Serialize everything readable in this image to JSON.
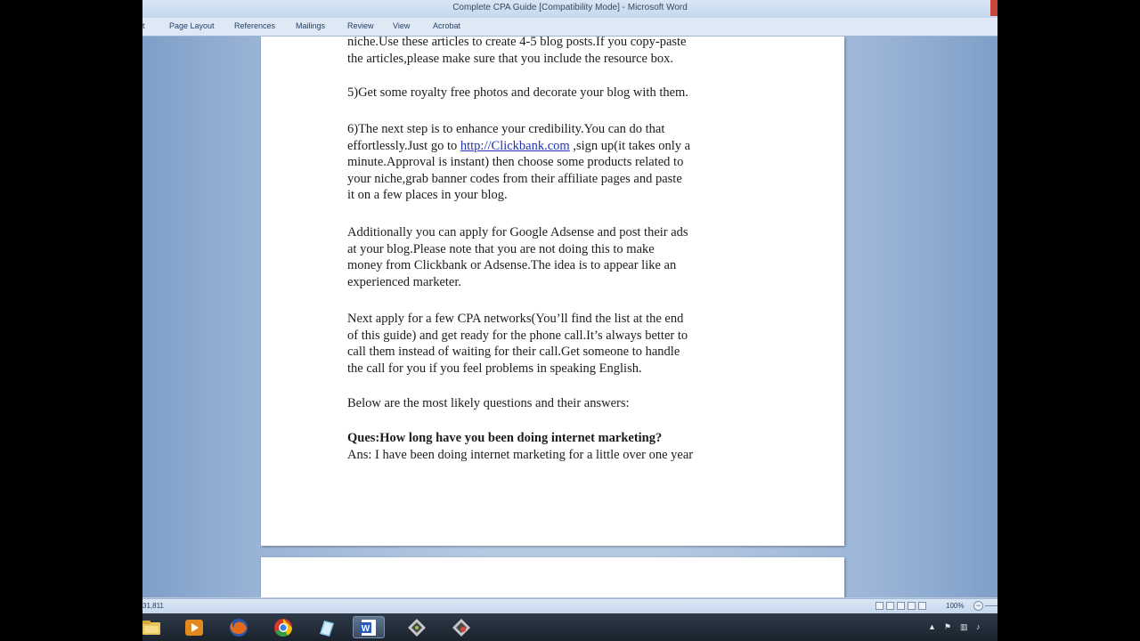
{
  "window": {
    "title": "Complete CPA Guide [Compatibility Mode] - Microsoft Word"
  },
  "ribbon": {
    "tabs": [
      "t",
      "Page Layout",
      "References",
      "Mailings",
      "Review",
      "View",
      "Acrobat"
    ]
  },
  "document": {
    "para1": [
      "niche.Use these articles to create 4-5 blog posts.If you copy-paste",
      "the articles,please make sure that you include the resource box."
    ],
    "para2": "5)Get some royalty free photos and decorate your blog with them.",
    "para3": {
      "l1": "6)The next step is to enhance your credibility.You can do that",
      "l2_pre": "effortlessly.Just go to ",
      "link": "http://Clickbank.com",
      "l2_post": " ,sign up(it takes only a",
      "l3": "minute.Approval is instant) then choose some products related to",
      "l4": "your niche,grab banner codes from their affiliate pages and paste",
      "l5": "it on a few places in your blog."
    },
    "para4": [
      "Additionally you can apply for Google Adsense and post their ads",
      "at your blog.Please note that you are not doing this to make",
      "money from Clickbank or Adsense.The idea is to appear like an",
      "experienced marketer."
    ],
    "para5": [
      "Next apply for a few CPA networks(You’ll find the list at the end",
      "of this guide) and get ready for the phone call.It’s always better to",
      "call them instead of waiting for their call.Get someone to handle",
      "the call for you if you feel problems in speaking English."
    ],
    "para6": "Below are the most likely questions and their answers:",
    "question": "Ques:How long have you been doing internet marketing?",
    "answer": "Ans: I have been doing internet marketing for a little over one year"
  },
  "status": {
    "words": "31,811",
    "zoom": "100%"
  },
  "taskbar": {
    "icons": [
      "explorer-icon",
      "media-player-icon",
      "firefox-icon",
      "chrome-icon",
      "notepad-icon",
      "word-icon",
      "app-icon-1",
      "app-icon-2"
    ]
  }
}
